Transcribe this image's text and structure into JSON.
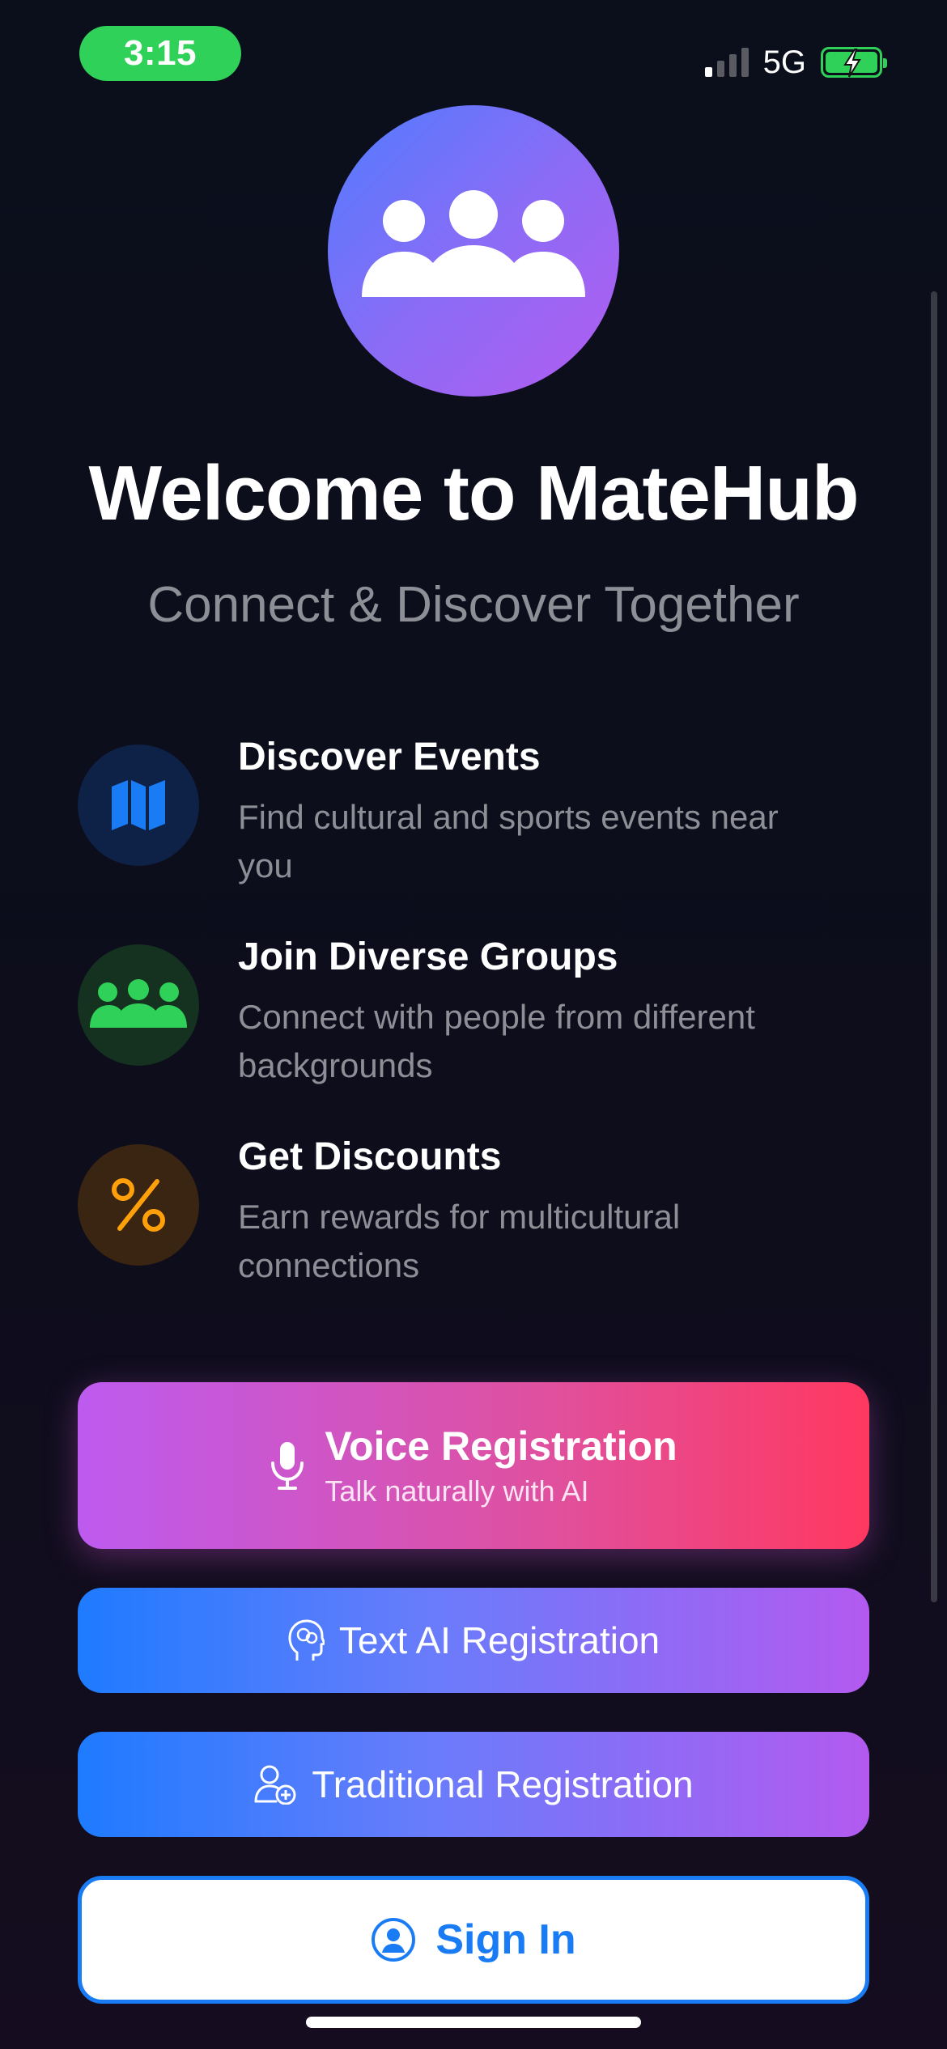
{
  "status_bar": {
    "time": "3:15",
    "network": "5G",
    "signal_bars_active": 1,
    "signal_bars_total": 4,
    "battery_charging": true,
    "accent_color": "#30d158"
  },
  "hero": {
    "logo_icon": "people-group-icon",
    "title": "Welcome to MateHub",
    "subtitle": "Connect & Discover Together"
  },
  "features": [
    {
      "icon": "map-icon",
      "color": "#1a7cf5",
      "title": "Discover Events",
      "desc": "Find cultural and sports events near you"
    },
    {
      "icon": "people-group-icon",
      "color": "#30d158",
      "title": "Join Diverse Groups",
      "desc": "Connect with people from different backgrounds"
    },
    {
      "icon": "percent-icon",
      "color": "#ff9f0a",
      "title": "Get Discounts",
      "desc": "Earn rewards for multicultural connections"
    }
  ],
  "buttons": {
    "voice": {
      "icon": "microphone-icon",
      "title": "Voice Registration",
      "subtitle": "Talk naturally with AI"
    },
    "text_ai": {
      "icon": "brain-head-icon",
      "label": "Text AI Registration"
    },
    "traditional": {
      "icon": "person-add-icon",
      "label": "Traditional Registration"
    },
    "sign_in": {
      "icon": "person-circle-icon",
      "label": "Sign In"
    }
  }
}
